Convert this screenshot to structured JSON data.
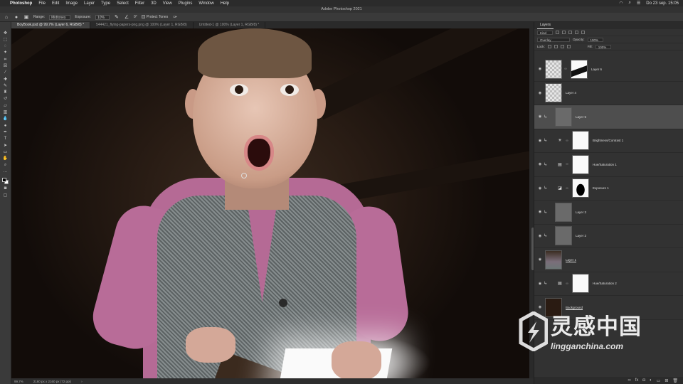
{
  "menubar": {
    "app_name": "Photoshop",
    "items": [
      "File",
      "Edit",
      "Image",
      "Layer",
      "Type",
      "Select",
      "Filter",
      "3D",
      "View",
      "Plugins",
      "Window",
      "Help"
    ],
    "clock": "Do 23 sep.  15:05"
  },
  "window_title": "Adobe Photoshop 2021",
  "options_bar": {
    "range_label": "Range:",
    "range_value": "Midtones",
    "exposure_label": "Exposure:",
    "exposure_value": "10%",
    "angle_value": "0°",
    "protect_tones_label": "Protect Tones"
  },
  "doc_tabs": [
    {
      "label": "BoyBook.psd @ 99,7% (Layer 6, RGB/8) *",
      "active": true
    },
    {
      "label": "544421_flying-papers-png.png @ 100% (Layer 1, RGB/8)",
      "active": false
    },
    {
      "label": "Untitled-1 @ 100% (Layer 1, RGB/8) *",
      "active": false
    }
  ],
  "status_bar": {
    "zoom": "99,7%",
    "doc_info": "2160 px x 2160 px (72 ppi)"
  },
  "layers_panel": {
    "tab_label": "Layers",
    "kind_filter": "Kind",
    "blend_mode": "Overlay",
    "opacity_label": "Opacity:",
    "opacity_value": "100%",
    "lock_label": "Lock:",
    "fill_label": "Fill:",
    "fill_value": "100%",
    "layers": [
      {
        "name": "Layer 6",
        "thumb": "checker",
        "mask": "mask-wing",
        "adj": "",
        "indent": false,
        "selected": false
      },
      {
        "name": "Layer 4",
        "thumb": "checker",
        "mask": "",
        "adj": "",
        "indent": false,
        "selected": false
      },
      {
        "name": "Layer 5",
        "thumb": "gray",
        "mask": "",
        "adj": "",
        "indent": true,
        "selected": true
      },
      {
        "name": "Brightness/Contrast 1",
        "thumb": "",
        "mask": "white",
        "adj": "☀",
        "indent": true,
        "selected": false
      },
      {
        "name": "Hue/Saturation 1",
        "thumb": "",
        "mask": "white",
        "adj": "▤",
        "indent": true,
        "selected": false
      },
      {
        "name": "Exposure 1",
        "thumb": "",
        "mask": "mask-blob",
        "adj": "◪",
        "indent": true,
        "selected": false
      },
      {
        "name": "Layer 3",
        "thumb": "gray",
        "mask": "",
        "adj": "",
        "indent": true,
        "selected": false
      },
      {
        "name": "Layer 2",
        "thumb": "gray",
        "mask": "",
        "adj": "",
        "indent": true,
        "selected": false
      },
      {
        "name": "Layer 1",
        "thumb": "boy",
        "mask": "",
        "adj": "",
        "indent": false,
        "selected": false
      },
      {
        "name": "Hue/Saturation 2",
        "thumb": "",
        "mask": "white",
        "adj": "▤",
        "indent": true,
        "selected": false
      },
      {
        "name": "Background",
        "thumb": "dark",
        "mask": "",
        "adj": "",
        "indent": false,
        "selected": false
      }
    ]
  },
  "watermark": {
    "cn": "灵感中国",
    "en": "lingganchina.com"
  }
}
